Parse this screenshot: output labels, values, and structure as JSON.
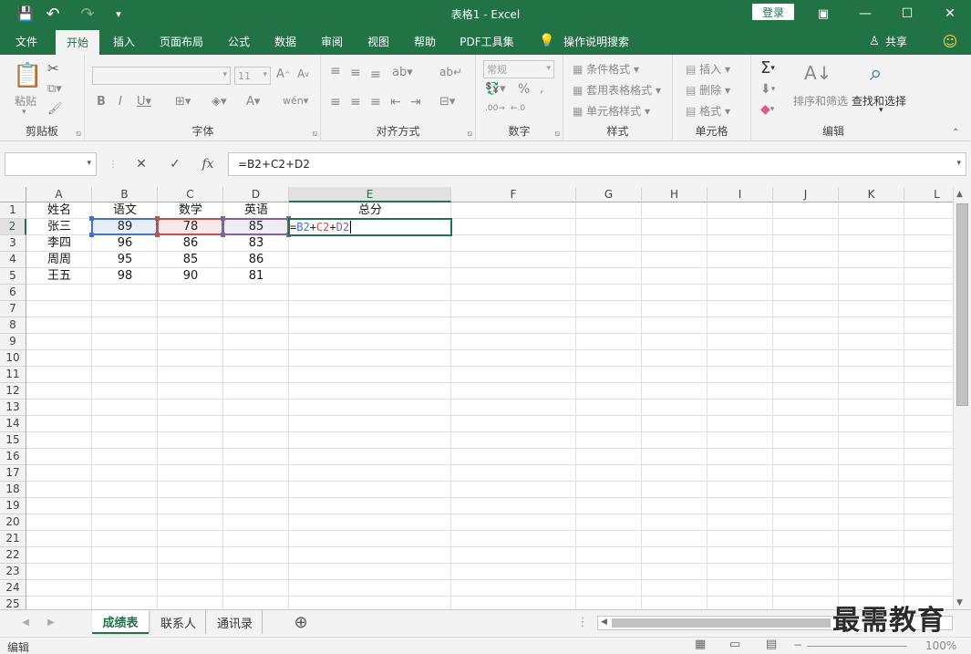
{
  "window": {
    "title": "表格1 - Excel",
    "login_label": "登录",
    "minimize": "—",
    "restore": "⧉",
    "maximize": "☐",
    "close": "✕"
  },
  "quick_access": {
    "save_icon": "💾",
    "undo_icon": "↶",
    "redo_icon": "↷",
    "customize_icon": "▾"
  },
  "tabs": [
    {
      "label": "文件"
    },
    {
      "label": "开始"
    },
    {
      "label": "插入"
    },
    {
      "label": "页面布局"
    },
    {
      "label": "公式"
    },
    {
      "label": "数据"
    },
    {
      "label": "审阅"
    },
    {
      "label": "视图"
    },
    {
      "label": "帮助"
    },
    {
      "label": "PDF工具集"
    },
    {
      "label": "操作说明搜索"
    }
  ],
  "share_label": "共享",
  "ribbon": {
    "clipboard": {
      "label": "剪贴板",
      "paste": "粘贴"
    },
    "font": {
      "label": "字体",
      "size": "11"
    },
    "alignment": {
      "label": "对齐方式"
    },
    "number": {
      "label": "数字",
      "format": "常规"
    },
    "styles": {
      "label": "样式",
      "conditional": "条件格式",
      "table": "套用表格格式",
      "cell_styles": "单元格样式"
    },
    "cells": {
      "label": "单元格",
      "insert": "插入",
      "delete": "删除",
      "format": "格式"
    },
    "editing": {
      "label": "编辑",
      "sort": "排序和筛选",
      "find": "查找和选择"
    }
  },
  "formula_bar": {
    "name_box": "",
    "cancel": "✕",
    "enter": "✓",
    "fx": "fx",
    "formula": "=B2+C2+D2"
  },
  "columns": [
    "A",
    "B",
    "C",
    "D",
    "E",
    "F",
    "G",
    "H",
    "I",
    "J",
    "K",
    "L"
  ],
  "rows": [
    "1",
    "2",
    "3",
    "4",
    "5",
    "6",
    "7",
    "8",
    "9",
    "10",
    "11",
    "12",
    "13",
    "14",
    "15",
    "16",
    "17",
    "18",
    "19",
    "20",
    "21",
    "22",
    "23",
    "24",
    "25"
  ],
  "table": {
    "headers": [
      "姓名",
      "语文",
      "数学",
      "英语",
      "总分"
    ],
    "data": [
      [
        "张三",
        "89",
        "78",
        "85"
      ],
      [
        "李四",
        "96",
        "86",
        "83"
      ],
      [
        "周周",
        "95",
        "85",
        "86"
      ],
      [
        "王五",
        "98",
        "90",
        "81"
      ]
    ]
  },
  "editing_formula": {
    "eq": "=",
    "r1": "B2",
    "p1": "+",
    "r2": "C2",
    "p2": "+",
    "r3": "D2"
  },
  "ref_colors": {
    "b": "#4472c4",
    "c": "#c0504d",
    "d": "#8064a2",
    "active": "#217346"
  },
  "sheets": [
    {
      "label": "成绩表"
    },
    {
      "label": "联系人"
    },
    {
      "label": "通讯录"
    }
  ],
  "status": {
    "mode": "编辑",
    "zoom": "100%"
  },
  "watermark": "最需教育"
}
